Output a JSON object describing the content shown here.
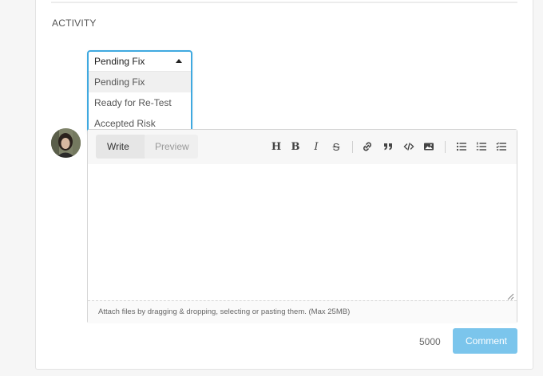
{
  "activity": {
    "heading": "ACTIVITY"
  },
  "status_select": {
    "selected": "Pending Fix",
    "options": [
      "Pending Fix",
      "Ready for Re-Test",
      "Accepted Risk"
    ]
  },
  "editor": {
    "tabs": [
      {
        "label": "Write",
        "active": true
      },
      {
        "label": "Preview",
        "active": false
      }
    ],
    "toolbar_icons": [
      "heading-icon",
      "bold-icon",
      "italic-icon",
      "strikethrough-icon",
      "link-icon",
      "quote-icon",
      "code-icon",
      "image-icon",
      "bulleted-list-icon",
      "numbered-list-icon",
      "task-list-icon"
    ],
    "toolbar_glyphs": {
      "heading": "H",
      "bold": "B",
      "italic": "I",
      "strike": "S"
    },
    "textarea_value": "",
    "attach_hint": "Attach files by dragging & dropping, selecting or pasting them. (Max 25MB)"
  },
  "footer": {
    "char_count": "5000",
    "comment_label": "Comment"
  },
  "colors": {
    "accent": "#3fa9e0",
    "comment_button": "#7bc5ec"
  }
}
